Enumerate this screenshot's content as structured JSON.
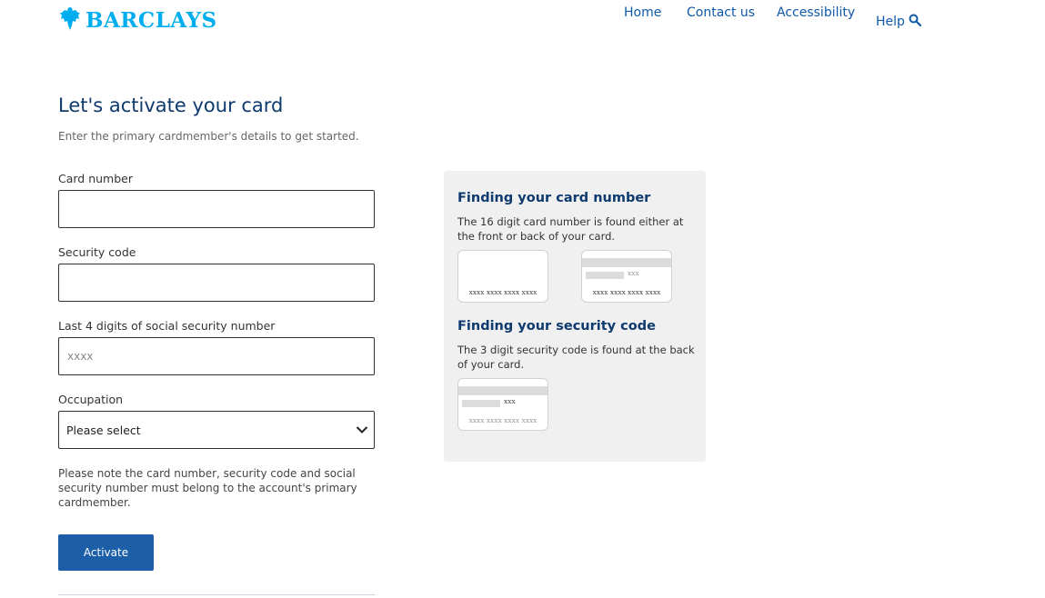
{
  "header": {
    "brand": "BARCLAYS",
    "nav": {
      "home": "Home",
      "contact": "Contact us",
      "accessibility": "Accessibility",
      "help": "Help"
    }
  },
  "main": {
    "title": "Let's activate your card",
    "subtitle": "Enter the primary cardmember's details to get started.",
    "fields": {
      "card_number": {
        "label": "Card number",
        "value": "",
        "placeholder": ""
      },
      "security_code": {
        "label": "Security code",
        "value": "",
        "placeholder": ""
      },
      "ssn_last4": {
        "label": "Last 4 digits of social security number",
        "value": "",
        "placeholder": "xxxx"
      },
      "occupation": {
        "label": "Occupation",
        "selected": "Please select"
      }
    },
    "note": "Please note the card number, security code and social security number must belong to the account's primary cardmember.",
    "activate_label": "Activate"
  },
  "help_panel": {
    "card_number_heading": "Finding your card number",
    "card_number_text": "The 16 digit card number is found either at the front or back of your card.",
    "security_heading": "Finding your security code",
    "security_text": "The 3 digit security code is found at the back of your card.",
    "card_number_mask": "xxxx xxxx xxxx xxxx",
    "security_mask": "xxx"
  },
  "colors": {
    "brand_blue": "#00aeef",
    "heading_navy": "#0e3a6e",
    "button_blue": "#1d5ea8",
    "panel_bg": "#f0f0f0"
  }
}
